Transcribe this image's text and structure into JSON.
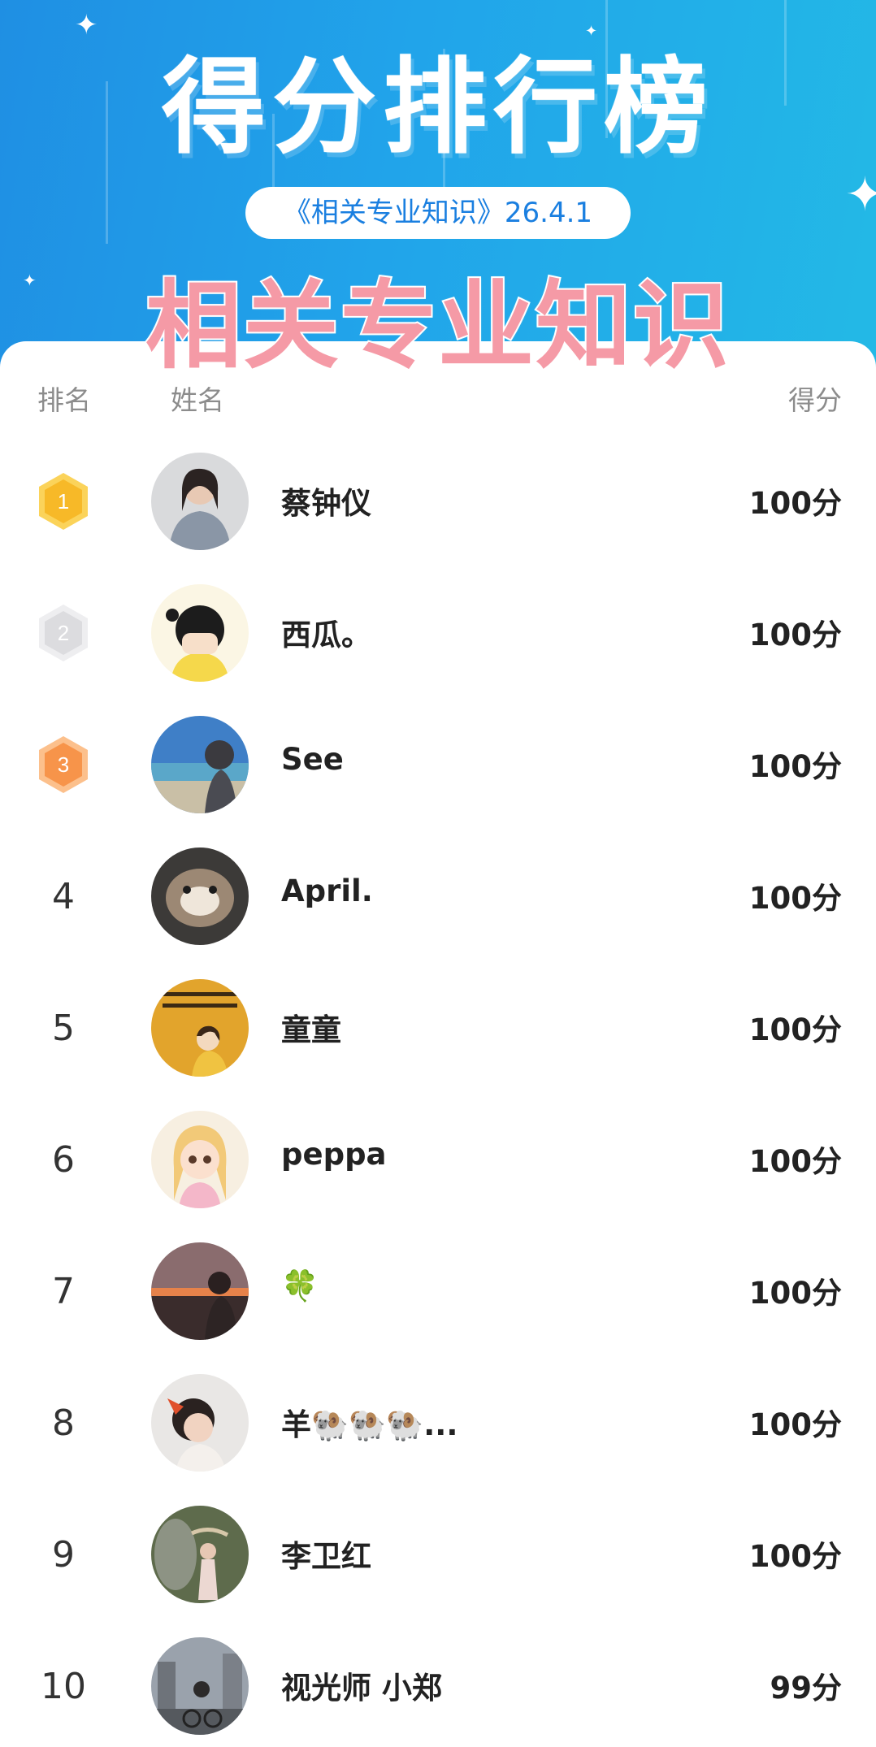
{
  "header": {
    "title": "得分排行榜",
    "quiz_pill": "《相关专业知识》26.4.1",
    "overlay_caption": "相关专业知识"
  },
  "table": {
    "col_rank": "排名",
    "col_name": "姓名",
    "col_score": "得分"
  },
  "rows": [
    {
      "rank": "1",
      "name": "蔡钟仪",
      "score": "100分",
      "medal": "gold"
    },
    {
      "rank": "2",
      "name": "西瓜。",
      "score": "100分",
      "medal": "silver"
    },
    {
      "rank": "3",
      "name": "See",
      "score": "100分",
      "medal": "bronze"
    },
    {
      "rank": "4",
      "name": "April.",
      "score": "100分"
    },
    {
      "rank": "5",
      "name": "童童",
      "score": "100分"
    },
    {
      "rank": "6",
      "name": "peppa",
      "score": "100分"
    },
    {
      "rank": "7",
      "name": "🍀",
      "score": "100分"
    },
    {
      "rank": "8",
      "name": "羊🐏🐏🐏...",
      "score": "100分"
    },
    {
      "rank": "9",
      "name": "李卫红",
      "score": "100分"
    },
    {
      "rank": "10",
      "name": "视光师 小郑",
      "score": "99分"
    }
  ],
  "colors": {
    "header_blue": "#1f8fe3",
    "header_cyan": "#23b9e6",
    "overlay_pink": "#f59aa6",
    "gold": "#f9c132",
    "silver": "#e2e2e4",
    "bronze": "#f9a15c"
  }
}
